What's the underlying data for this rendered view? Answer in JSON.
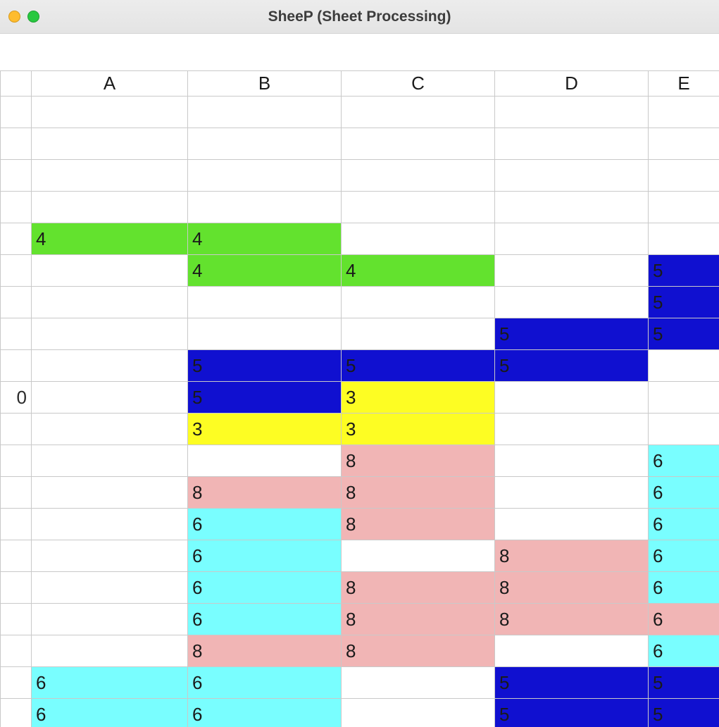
{
  "window": {
    "title": "SheeP (Sheet Processing)"
  },
  "colors": {
    "green": "#63e22e",
    "blue": "#1010d0",
    "yellow": "#fdfd23",
    "pink": "#f1b5b5",
    "cyan": "#79feff"
  },
  "columns": [
    "",
    "A",
    "B",
    "C",
    "D",
    "E"
  ],
  "row_headers": [
    "",
    "",
    "",
    "",
    "",
    "",
    "",
    "",
    "",
    "0",
    "",
    "",
    "",
    "",
    "",
    "",
    "",
    "",
    ""
  ],
  "cells": [
    [
      {
        "v": ""
      },
      {
        "v": ""
      },
      {
        "v": ""
      },
      {
        "v": ""
      },
      {
        "v": ""
      }
    ],
    [
      {
        "v": ""
      },
      {
        "v": ""
      },
      {
        "v": ""
      },
      {
        "v": ""
      },
      {
        "v": ""
      }
    ],
    [
      {
        "v": ""
      },
      {
        "v": ""
      },
      {
        "v": ""
      },
      {
        "v": ""
      },
      {
        "v": ""
      }
    ],
    [
      {
        "v": ""
      },
      {
        "v": ""
      },
      {
        "v": ""
      },
      {
        "v": ""
      },
      {
        "v": ""
      }
    ],
    [
      {
        "v": "4",
        "c": "green"
      },
      {
        "v": "4",
        "c": "green"
      },
      {
        "v": ""
      },
      {
        "v": ""
      },
      {
        "v": ""
      }
    ],
    [
      {
        "v": ""
      },
      {
        "v": "4",
        "c": "green"
      },
      {
        "v": "4",
        "c": "green"
      },
      {
        "v": ""
      },
      {
        "v": "5",
        "c": "blue"
      }
    ],
    [
      {
        "v": ""
      },
      {
        "v": ""
      },
      {
        "v": ""
      },
      {
        "v": ""
      },
      {
        "v": "5",
        "c": "blue"
      }
    ],
    [
      {
        "v": ""
      },
      {
        "v": ""
      },
      {
        "v": ""
      },
      {
        "v": "5",
        "c": "blue"
      },
      {
        "v": "5",
        "c": "blue"
      }
    ],
    [
      {
        "v": ""
      },
      {
        "v": "5",
        "c": "blue"
      },
      {
        "v": "5",
        "c": "blue"
      },
      {
        "v": "5",
        "c": "blue"
      },
      {
        "v": ""
      }
    ],
    [
      {
        "v": ""
      },
      {
        "v": "5",
        "c": "blue"
      },
      {
        "v": "3",
        "c": "yellow"
      },
      {
        "v": ""
      },
      {
        "v": ""
      }
    ],
    [
      {
        "v": ""
      },
      {
        "v": "3",
        "c": "yellow"
      },
      {
        "v": "3",
        "c": "yellow"
      },
      {
        "v": ""
      },
      {
        "v": ""
      }
    ],
    [
      {
        "v": ""
      },
      {
        "v": ""
      },
      {
        "v": "8",
        "c": "pink"
      },
      {
        "v": ""
      },
      {
        "v": "6",
        "c": "cyan"
      }
    ],
    [
      {
        "v": ""
      },
      {
        "v": "8",
        "c": "pink"
      },
      {
        "v": "8",
        "c": "pink"
      },
      {
        "v": ""
      },
      {
        "v": "6",
        "c": "cyan"
      }
    ],
    [
      {
        "v": ""
      },
      {
        "v": "6",
        "c": "cyan"
      },
      {
        "v": "8",
        "c": "pink"
      },
      {
        "v": ""
      },
      {
        "v": "6",
        "c": "cyan"
      }
    ],
    [
      {
        "v": ""
      },
      {
        "v": "6",
        "c": "cyan"
      },
      {
        "v": ""
      },
      {
        "v": "8",
        "c": "pink"
      },
      {
        "v": "6",
        "c": "cyan"
      }
    ],
    [
      {
        "v": ""
      },
      {
        "v": "6",
        "c": "cyan"
      },
      {
        "v": "8",
        "c": "pink"
      },
      {
        "v": "8",
        "c": "pink"
      },
      {
        "v": "6",
        "c": "cyan"
      }
    ],
    [
      {
        "v": ""
      },
      {
        "v": "6",
        "c": "cyan"
      },
      {
        "v": "8",
        "c": "pink"
      },
      {
        "v": "8",
        "c": "pink"
      },
      {
        "v": "6",
        "c": "pink"
      }
    ],
    [
      {
        "v": ""
      },
      {
        "v": "8",
        "c": "pink"
      },
      {
        "v": "8",
        "c": "pink"
      },
      {
        "v": ""
      },
      {
        "v": "6",
        "c": "cyan"
      }
    ],
    [
      {
        "v": "6",
        "c": "cyan"
      },
      {
        "v": "6",
        "c": "cyan"
      },
      {
        "v": ""
      },
      {
        "v": "5",
        "c": "blue"
      },
      {
        "v": "5",
        "c": "blue"
      }
    ],
    [
      {
        "v": "6",
        "c": "cyan"
      },
      {
        "v": "6",
        "c": "cyan"
      },
      {
        "v": ""
      },
      {
        "v": "5",
        "c": "blue"
      },
      {
        "v": "5",
        "c": "blue"
      }
    ]
  ]
}
